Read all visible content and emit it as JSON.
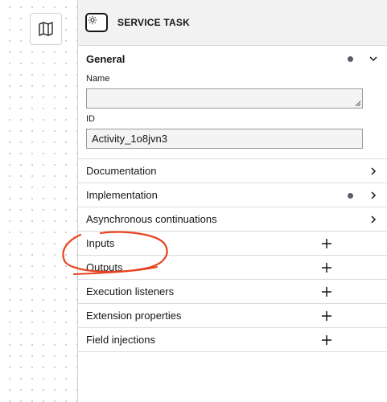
{
  "canvas": {
    "map_icon": "map-icon"
  },
  "panel": {
    "header": {
      "icon": "gear-icon",
      "title": "SERVICE TASK"
    },
    "general": {
      "label": "General",
      "name_label": "Name",
      "name_value": "",
      "id_label": "ID",
      "id_value": "Activity_1o8jvn3"
    },
    "groups": [
      {
        "label": "Documentation",
        "action": "chevron-right-icon",
        "has_dot": false
      },
      {
        "label": "Implementation",
        "action": "chevron-right-icon",
        "has_dot": true
      },
      {
        "label": "Asynchronous continuations",
        "action": "chevron-right-icon",
        "has_dot": false
      },
      {
        "label": "Inputs",
        "action": "plus-icon",
        "has_dot": false
      },
      {
        "label": "Outputs",
        "action": "plus-icon",
        "has_dot": false
      },
      {
        "label": "Execution listeners",
        "action": "plus-icon",
        "has_dot": false
      },
      {
        "label": "Extension properties",
        "action": "plus-icon",
        "has_dot": false
      },
      {
        "label": "Field injections",
        "action": "plus-icon",
        "has_dot": false
      }
    ]
  },
  "colors": {
    "annotation": "#e8421f",
    "header_bg": "#f2f2f2",
    "dot": "#5b5b6b"
  }
}
